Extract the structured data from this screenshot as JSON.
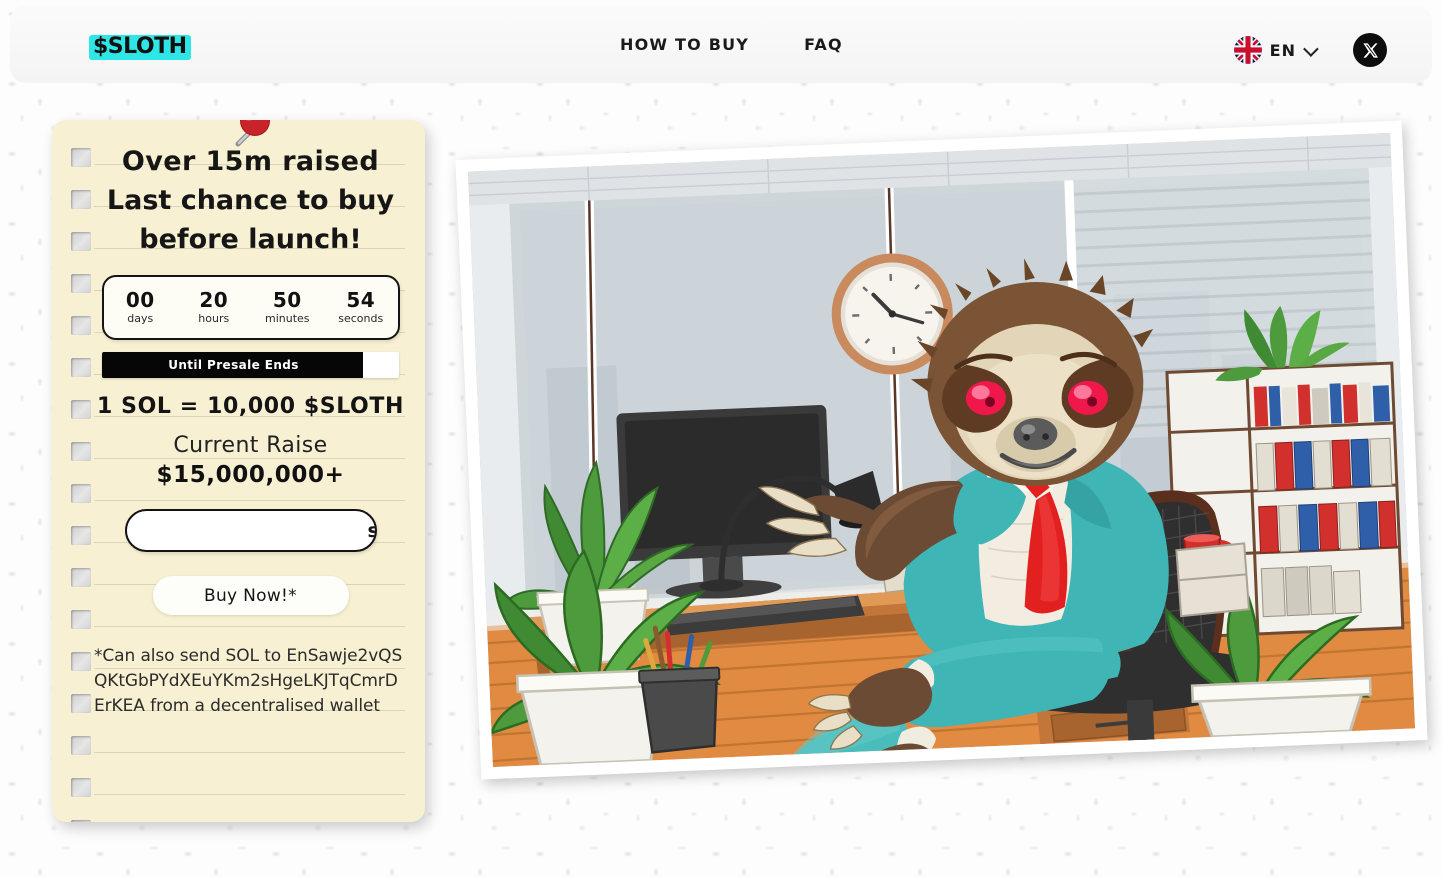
{
  "header": {
    "logo": "$SLOTH",
    "nav": [
      {
        "label": "HOW TO BUY",
        "name": "nav-how-to-buy"
      },
      {
        "label": "FAQ",
        "name": "nav-faq"
      }
    ],
    "language": {
      "code": "EN",
      "flag_icon": "uk-flag-icon",
      "chevron_icon": "chevron-down-icon"
    },
    "social": {
      "x_icon": "x-twitter-icon"
    }
  },
  "presale_card": {
    "pushpin_icon": "red-pushpin-icon",
    "headline": {
      "line1": "Over 15m raised",
      "line2": "Last chance to buy",
      "line3": "before launch!"
    },
    "countdown": [
      {
        "value": "00",
        "label": "days"
      },
      {
        "value": "20",
        "label": "hours"
      },
      {
        "value": "50",
        "label": "minutes"
      },
      {
        "value": "54",
        "label": "seconds"
      }
    ],
    "progress": {
      "label": "Until Presale Ends",
      "percent": 88
    },
    "rate": "1 SOL = 10,000 $SLOTH",
    "raise_label": "Current Raise",
    "raise_amount": "$15,000,000+",
    "amount_input": {
      "value": "",
      "placeholder": "",
      "unit": "sol"
    },
    "buy_button": "Buy Now!*",
    "footnote": {
      "line1": "*Can also send SOL to",
      "address": "EnSawje2vQSQKtGbPYdXEuYKm2sHgeLKJTqCmrDErKEA",
      "line3": "from a decentralised wallet"
    }
  },
  "hero": {
    "alt": "Cartoon sloth in teal business suit with red tie sitting in office chair",
    "icon": "sloth-office-illustration"
  },
  "colors": {
    "accent_cyan": "#2ee6e6",
    "paper": "#f7f0d2",
    "ink": "#111111",
    "suit_teal": "#3fb5b5",
    "tie_red": "#e32020",
    "pin_red": "#c9232a"
  }
}
